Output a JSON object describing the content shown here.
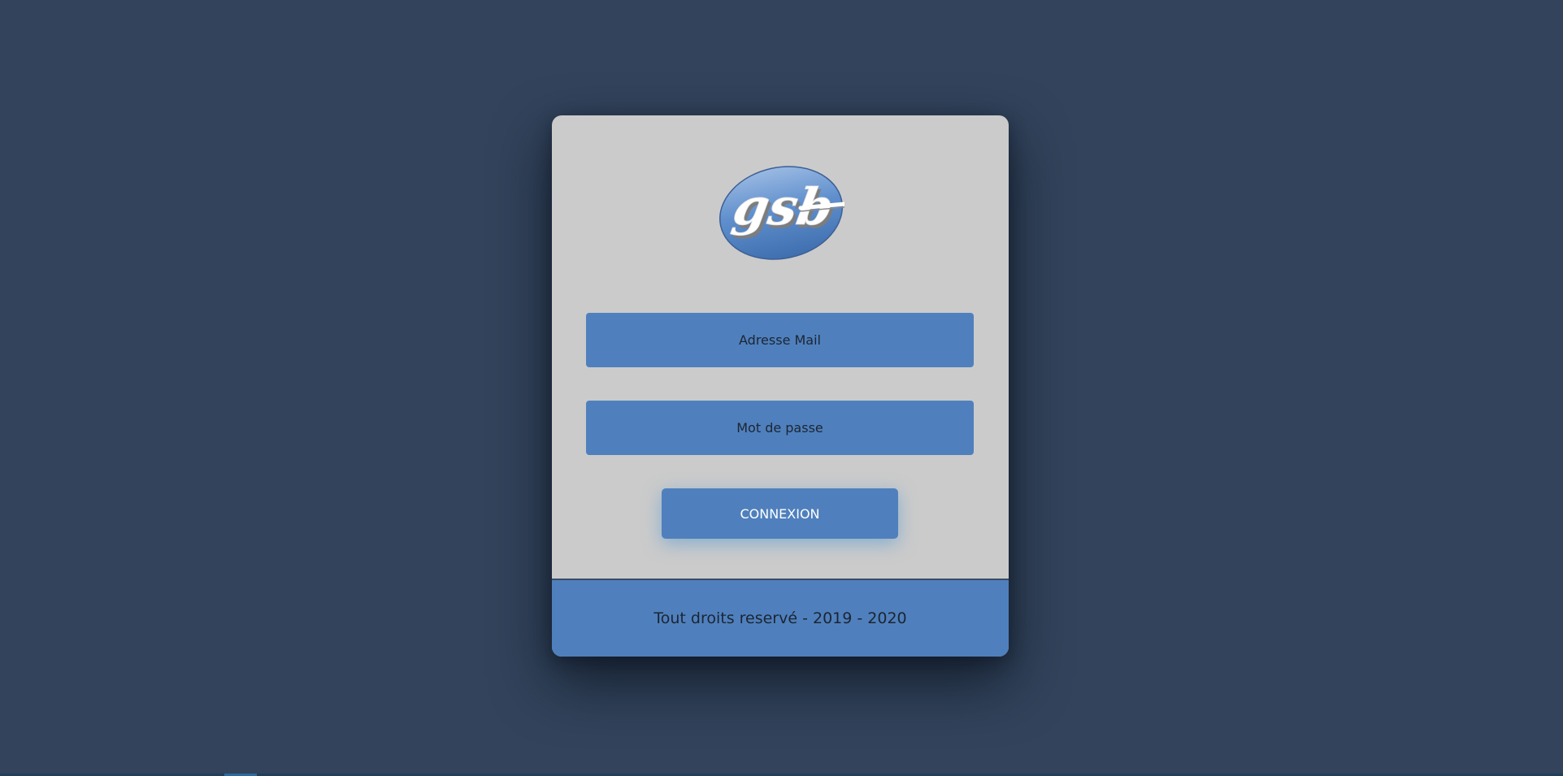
{
  "logo": {
    "text": "gsb",
    "icon": "gsb-logo"
  },
  "form": {
    "email_placeholder": "Adresse Mail",
    "password_placeholder": "Mot de passe",
    "submit_label": "CONNEXION"
  },
  "footer": {
    "text": "Tout droits reservé - 2019 - 2020"
  },
  "colors": {
    "background": "#32435b",
    "card": "#cbcbcb",
    "accent": "#4f80bd",
    "text_dark": "#1c2533",
    "button_text": "#ffffff"
  }
}
